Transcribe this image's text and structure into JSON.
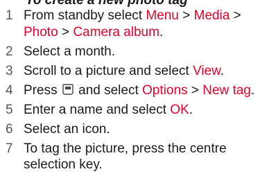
{
  "heading": "To create a new photo tag",
  "colors": {
    "text": "#1a1a1a",
    "highlight": "#e2002a",
    "number": "#555555"
  },
  "steps": [
    {
      "num": "1",
      "parts": [
        {
          "t": "From standby select "
        },
        {
          "t": "Menu",
          "hl": true
        },
        {
          "t": " > "
        },
        {
          "t": "Media",
          "hl": true
        },
        {
          "t": " > "
        },
        {
          "t": "Photo",
          "hl": true
        },
        {
          "t": " > "
        },
        {
          "t": "Camera album",
          "hl": true
        },
        {
          "t": "."
        }
      ]
    },
    {
      "num": "2",
      "parts": [
        {
          "t": "Select a month."
        }
      ]
    },
    {
      "num": "3",
      "parts": [
        {
          "t": "Scroll to a picture and select "
        },
        {
          "t": "View",
          "hl": true
        },
        {
          "t": "."
        }
      ]
    },
    {
      "num": "4",
      "parts": [
        {
          "t": "Press "
        },
        {
          "icon": "options-key-icon"
        },
        {
          "t": " and select "
        },
        {
          "t": "Options",
          "hl": true
        },
        {
          "t": " > "
        },
        {
          "t": "New tag",
          "hl": true
        },
        {
          "t": "."
        }
      ]
    },
    {
      "num": "5",
      "parts": [
        {
          "t": "Enter a name and select "
        },
        {
          "t": "OK",
          "hl": true
        },
        {
          "t": "."
        }
      ]
    },
    {
      "num": "6",
      "parts": [
        {
          "t": "Select an icon."
        }
      ]
    },
    {
      "num": "7",
      "parts": [
        {
          "t": "To tag the picture, press the centre selection key."
        }
      ]
    }
  ]
}
